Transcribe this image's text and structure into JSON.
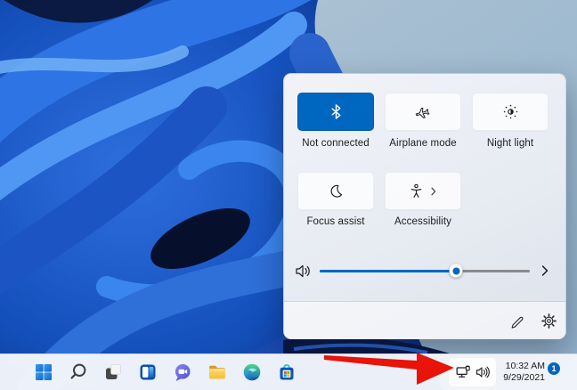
{
  "colors": {
    "accent": "#0067c0",
    "panel_bg": "#e9edf4",
    "taskbar_bg": "#f3f6fb",
    "arrow": "#e81309"
  },
  "quick_settings": {
    "tiles": [
      {
        "label": "Not connected",
        "icon": "bluetooth-icon",
        "active": true
      },
      {
        "label": "Airplane mode",
        "icon": "airplane-icon",
        "active": false
      },
      {
        "label": "Night light",
        "icon": "night-light-icon",
        "active": false
      },
      {
        "label": "Focus assist",
        "icon": "focus-assist-icon",
        "active": false
      },
      {
        "label": "Accessibility",
        "icon": "accessibility-icon",
        "active": false,
        "chevron": true
      }
    ],
    "volume": {
      "percent": 65,
      "icon": "volume-icon",
      "expand_icon": "chevron-right-icon"
    },
    "footer": {
      "edit_icon": "pencil-icon",
      "settings_icon": "gear-icon"
    }
  },
  "taskbar": {
    "buttons": [
      {
        "name": "start"
      },
      {
        "name": "search"
      },
      {
        "name": "task-view"
      },
      {
        "name": "widgets"
      },
      {
        "name": "chat"
      },
      {
        "name": "file-explorer"
      },
      {
        "name": "edge"
      },
      {
        "name": "microsoft-store"
      }
    ],
    "tray": {
      "icons": [
        "network",
        "volume"
      ],
      "time": "10:32 AM",
      "date": "9/29/2021",
      "notification_count": "1"
    }
  },
  "annotation": {
    "shape": "arrow",
    "color": "#e81309"
  }
}
